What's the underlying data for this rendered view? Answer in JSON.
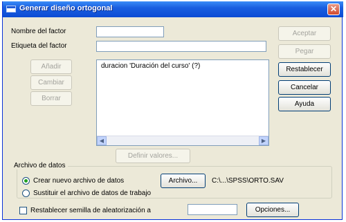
{
  "window": {
    "title": "Generar diseño ortogonal",
    "close_glyph": "✕"
  },
  "form": {
    "factor_name_label": "Nombre del factor",
    "factor_label_label": "Etiqueta del factor",
    "factor_name_value": "",
    "factor_label_value": ""
  },
  "list_buttons": {
    "add": "Añadir",
    "change": "Cambiar",
    "remove": "Borrar"
  },
  "factor_list": {
    "items": [
      "duracion 'Duración del curso' (?)"
    ]
  },
  "define_values_button": "Definir valores...",
  "side_buttons": {
    "ok": "Aceptar",
    "paste": "Pegar",
    "reset": "Restablecer",
    "cancel": "Cancelar",
    "help": "Ayuda"
  },
  "data_file": {
    "group_title": "Archivo de datos",
    "option_new": "Crear nuevo archivo de datos",
    "option_replace": "Sustituir el archivo de datos de trabajo",
    "file_button": "Archivo...",
    "file_path": "C:\\...\\SPSS\\ORTO.SAV",
    "selected_option": "new"
  },
  "seed": {
    "label": "Restablecer semilla de aleatorización a",
    "value": "",
    "checked": false
  },
  "options_button": "Opciones..."
}
